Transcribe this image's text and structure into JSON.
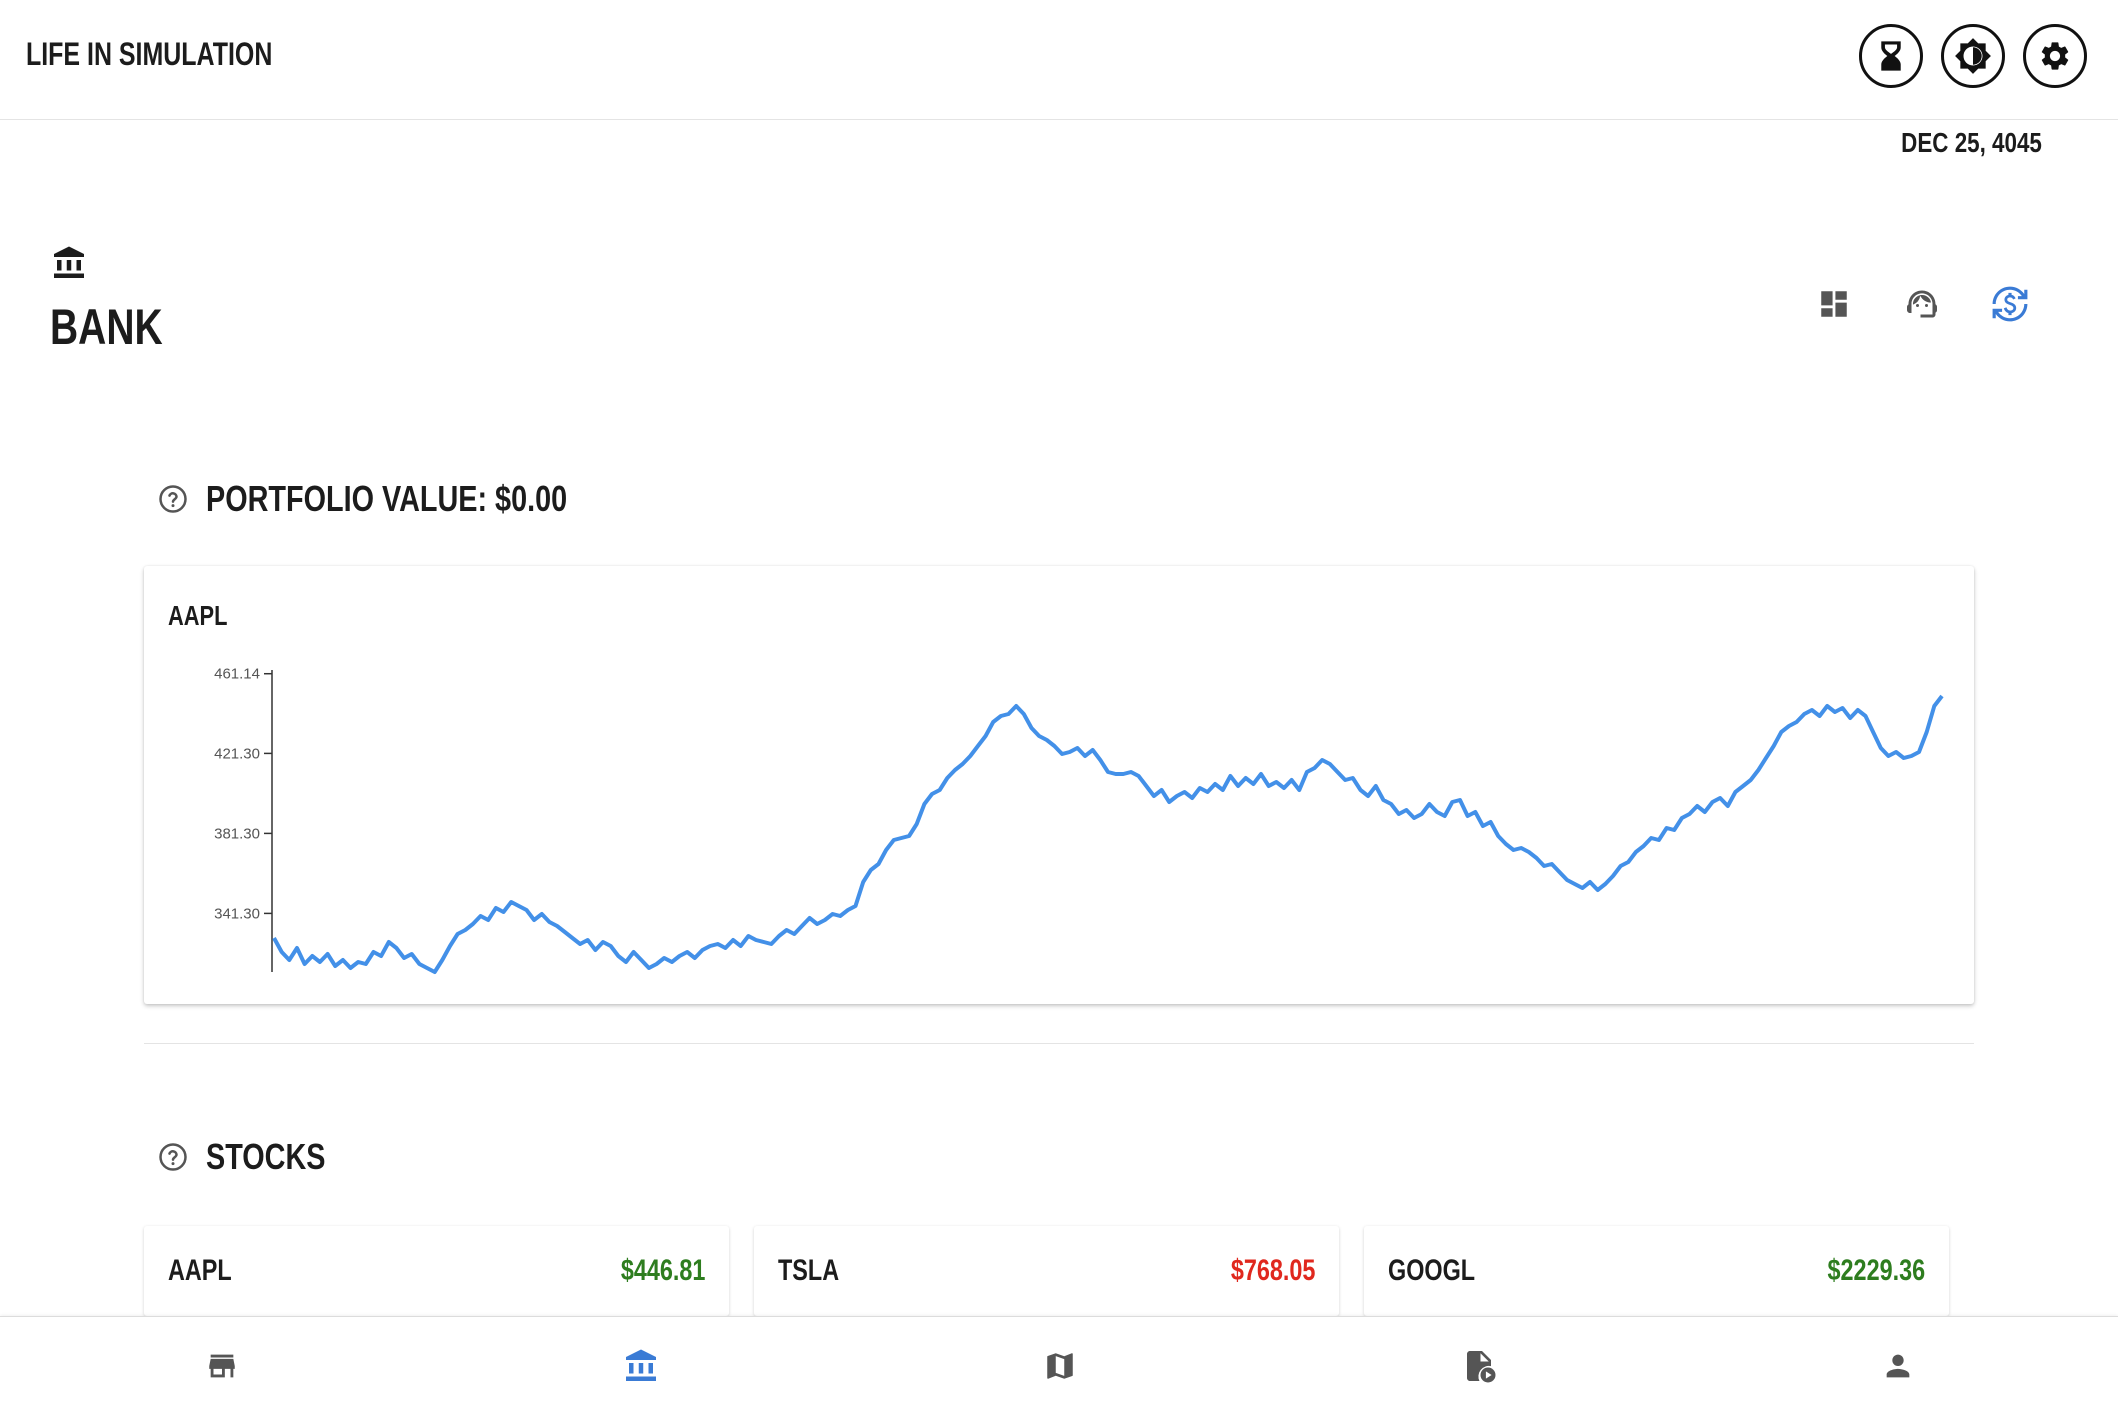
{
  "app": {
    "title": "LIFE IN SIMULATION",
    "date": "DEC 25, 4045"
  },
  "header_icons": [
    "hourglass-icon",
    "contrast-icon",
    "gear-icon"
  ],
  "page": {
    "title": "BANK",
    "icon": "bank-icon",
    "tools": [
      "dashboard-icon",
      "support-agent-icon",
      "currency-exchange-icon"
    ],
    "active_tool": "currency-exchange-icon"
  },
  "portfolio": {
    "title": "PORTFOLIO VALUE: $0.00"
  },
  "stocks_section": {
    "title": "STOCKS"
  },
  "colors": {
    "accent": "#3a7bd5",
    "line": "#4390e8",
    "positive": "#2e7d1f",
    "negative": "#e0281e"
  },
  "chart_data": {
    "type": "line",
    "title": "AAPL",
    "y_ticks": [
      "461.14",
      "421.30",
      "381.30",
      "341.30"
    ],
    "ylim": [
      312,
      462
    ],
    "series": [
      {
        "values": [
          329,
          322,
          318,
          324,
          316,
          320,
          317,
          321,
          315,
          318,
          314,
          317,
          316,
          322,
          320,
          327,
          324,
          319,
          321,
          316,
          314,
          312,
          318,
          325,
          331,
          333,
          336,
          340,
          338,
          344,
          342,
          347,
          345,
          343,
          338,
          341,
          337,
          335,
          332,
          329,
          326,
          328,
          323,
          327,
          325,
          320,
          317,
          322,
          318,
          314,
          316,
          319,
          317,
          320,
          322,
          319,
          323,
          325,
          326,
          324,
          328,
          325,
          330,
          328,
          327,
          326,
          330,
          333,
          331,
          335,
          339,
          336,
          338,
          341,
          340,
          343,
          345,
          357,
          363,
          366,
          373,
          378,
          379,
          380,
          386,
          396,
          401,
          403,
          409,
          413,
          416,
          420,
          425,
          430,
          437,
          440,
          441,
          445,
          441,
          434,
          430,
          428,
          425,
          421,
          422,
          424,
          420,
          423,
          418,
          412,
          411,
          411,
          412,
          410,
          405,
          400,
          403,
          397,
          400,
          402,
          399,
          404,
          402,
          406,
          403,
          410,
          405,
          409,
          406,
          411,
          405,
          407,
          404,
          408,
          403,
          412,
          414,
          418,
          416,
          412,
          408,
          409,
          403,
          400,
          405,
          398,
          396,
          391,
          393,
          389,
          391,
          396,
          392,
          390,
          397,
          398,
          390,
          392,
          385,
          387,
          380,
          376,
          373,
          374,
          372,
          369,
          365,
          366,
          362,
          358,
          356,
          354,
          357,
          353,
          356,
          360,
          365,
          367,
          372,
          375,
          379,
          378,
          384,
          383,
          389,
          391,
          395,
          392,
          397,
          399,
          395,
          402,
          405,
          408,
          413,
          419,
          425,
          432,
          435,
          437,
          441,
          443,
          440,
          445,
          442,
          444,
          439,
          443,
          440,
          432,
          424,
          420,
          422,
          419,
          420,
          422,
          432,
          445,
          450
        ]
      }
    ]
  },
  "stocks": [
    {
      "symbol": "AAPL",
      "price": "$446.81",
      "trend": "up"
    },
    {
      "symbol": "TSLA",
      "price": "$768.05",
      "trend": "down"
    },
    {
      "symbol": "GOOGL",
      "price": "$2229.36",
      "trend": "up"
    }
  ],
  "bottom_nav": [
    {
      "icon": "store-icon",
      "active": false
    },
    {
      "icon": "bank-icon",
      "active": true
    },
    {
      "icon": "map-icon",
      "active": false
    },
    {
      "icon": "media-play-icon",
      "active": false
    },
    {
      "icon": "person-icon",
      "active": false
    }
  ]
}
